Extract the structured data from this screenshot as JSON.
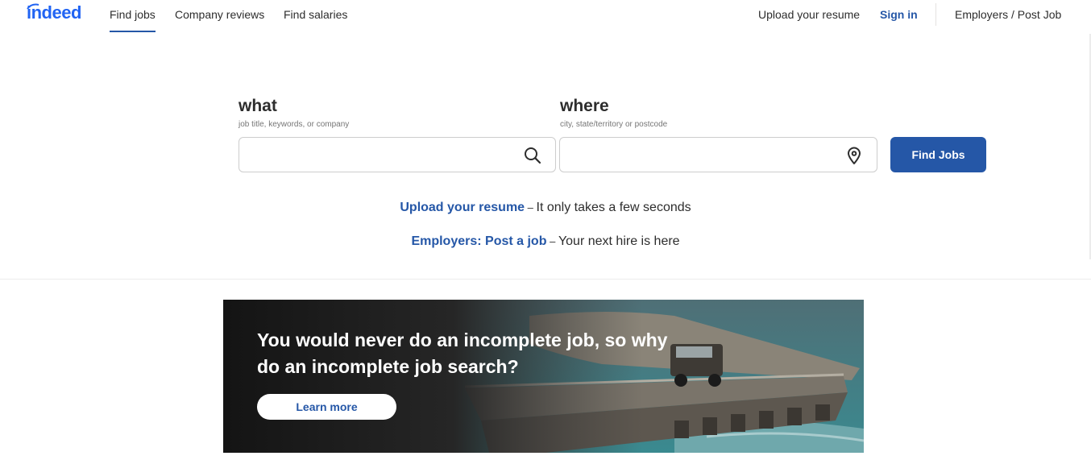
{
  "header": {
    "logo_text": "indeed",
    "nav": {
      "find_jobs": "Find jobs",
      "company_reviews": "Company reviews",
      "find_salaries": "Find salaries",
      "upload_resume": "Upload your resume",
      "sign_in": "Sign in",
      "employers": "Employers / Post Job"
    }
  },
  "search": {
    "what_label": "what",
    "what_sub": "job title, keywords, or company",
    "what_value": "",
    "what_icon": "search-icon",
    "where_label": "where",
    "where_sub": "city, state/territory or postcode",
    "where_value": "",
    "where_icon": "location-pin-icon",
    "button_label": "Find Jobs"
  },
  "promos": {
    "upload_link": "Upload your resume",
    "upload_dash": " – ",
    "upload_rest": "It only takes a few seconds",
    "post_link": "Employers: Post a job",
    "post_dash": " – ",
    "post_rest": "Your next hire is here"
  },
  "banner": {
    "headline": "You would never do an incomplete job, so why do an incomplete job search?",
    "button_label": "Learn more"
  },
  "colors": {
    "brand_blue": "#2557a7",
    "logo_blue": "#2164f3"
  }
}
